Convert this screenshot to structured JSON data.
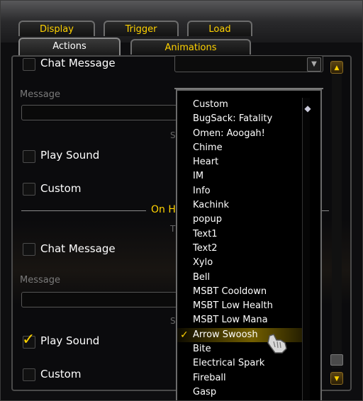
{
  "tabs_row1": [
    {
      "label": "Display"
    },
    {
      "label": "Trigger"
    },
    {
      "label": "Load"
    }
  ],
  "tabs_row2": [
    {
      "label": "Actions",
      "active": true
    },
    {
      "label": "Animations"
    }
  ],
  "section1": {
    "chat_message_label": "Chat Message",
    "message_label": "Message",
    "play_sound_label": "Play Sound",
    "custom_label": "Custom",
    "sound_fragment": "S"
  },
  "divider_header": "On H",
  "section2": {
    "partial_label": "T",
    "chat_message_label": "Chat Message",
    "message_label": "Message",
    "sound_fragment": "S",
    "play_sound_label": "Play Sound",
    "play_sound_checked": true,
    "custom_label": "Custom"
  },
  "dropdown": {
    "items": [
      "Custom",
      "BugSack: Fatality",
      "Omen: Aoogah!",
      "Chime",
      "Heart",
      "IM",
      "Info",
      "Kachink",
      "popup",
      "Text1",
      "Text2",
      "Xylo",
      "Bell",
      "MSBT Cooldown",
      "MSBT Low Health",
      "MSBT Low Mana",
      "Arrow Swoosh",
      "Bite",
      "Electrical Spark",
      "Fireball",
      "Gasp"
    ],
    "selected": "Arrow Swoosh"
  },
  "icons": [
    "chevron-down-icon",
    "checkmark-icon",
    "hand-cursor-icon",
    "scroll-up-icon",
    "scroll-down-icon"
  ],
  "colors": {
    "accent": "#ffd200",
    "text": "#ffffff",
    "muted": "#7a7a7a"
  }
}
